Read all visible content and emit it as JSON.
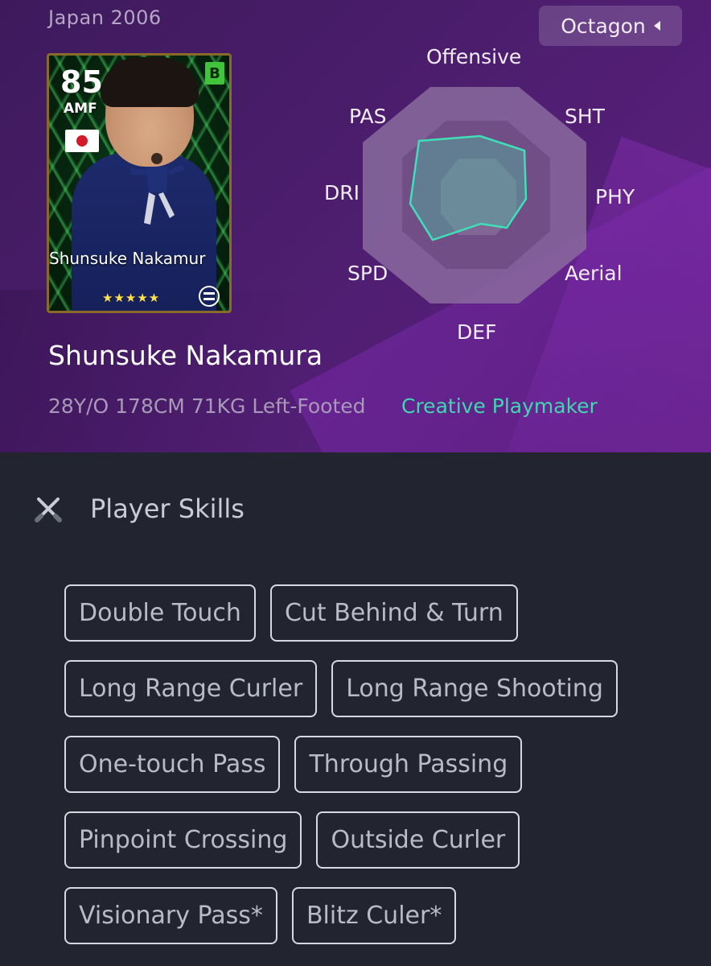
{
  "header": {
    "subtitle": "Japan 2006",
    "mode_button": "Octagon"
  },
  "card": {
    "rating": "85",
    "position": "AMF",
    "badge": "B",
    "name": "Shunsuke Nakamur",
    "stars": "★★★★★",
    "nation_flag": "japan-flag-icon"
  },
  "player": {
    "name": "Shunsuke Nakamura",
    "info": "28Y/O 178CM 71KG Left-Footed",
    "playstyle": "Creative Playmaker"
  },
  "radar": {
    "labels": {
      "offensive": "Offensive",
      "sht": "SHT",
      "phy": "PHY",
      "aerial": "Aerial",
      "def": "DEF",
      "spd": "SPD",
      "dri": "DRI",
      "pas": "PAS"
    },
    "colors": {
      "outer": "#8a6a9d",
      "inner": "#6f4c84",
      "stat_fill": "#4fb7a0",
      "stat_stroke": "#3fe0b8"
    }
  },
  "skills": {
    "title": "Player Skills",
    "icon": "crossed-swords-icon",
    "rows": [
      [
        "Double Touch",
        "Cut Behind & Turn"
      ],
      [
        "Long Range Curler",
        "Long Range Shooting"
      ],
      [
        "One-touch Pass",
        "Through Passing"
      ],
      [
        "Pinpoint Crossing",
        "Outside Curler"
      ],
      [
        "Visionary Pass*",
        "Blitz Culer*"
      ]
    ]
  }
}
